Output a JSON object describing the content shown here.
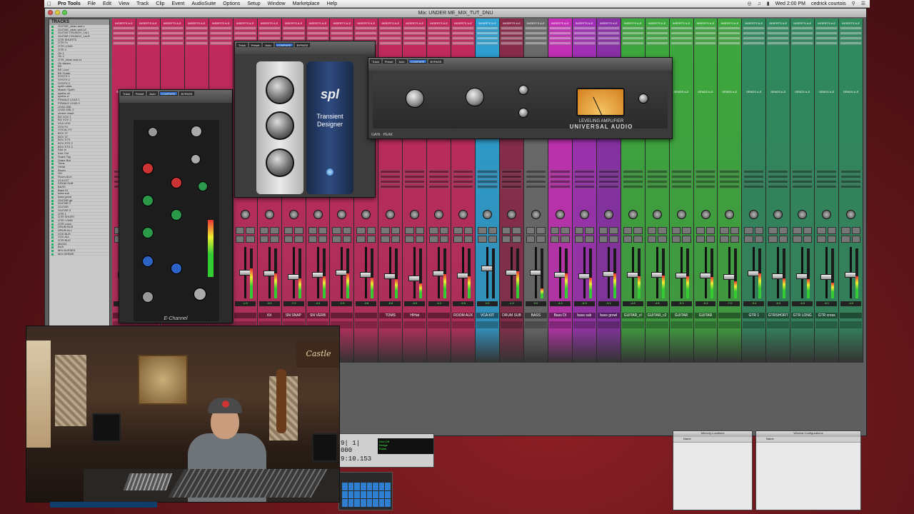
{
  "menubar": {
    "apple": "",
    "items": [
      "Pro Tools",
      "File",
      "Edit",
      "View",
      "Track",
      "Clip",
      "Event",
      "AudioSuite",
      "Options",
      "Setup",
      "Window",
      "Marketplace",
      "Help"
    ],
    "clock": "Wed 2:00 PM",
    "user": "cedrick courtois"
  },
  "window": {
    "title": "Mix: UNDER ME_MIX_TUT_DNU"
  },
  "tracks": {
    "header": "TRACKS",
    "items": [
      "GUITAR_clean and.c",
      "GUITAR_clean and.c2",
      "GUITAR CRUNCH_1st.L",
      "GUITAR CRUNCH_1st.R",
      "GTR SHORTS",
      "GTR Fx",
      "GTR LONG",
      "GTR 3",
      "Oh 1",
      "Oh 2",
      "GTR_clean and.c4",
      "Oh dream",
      "BS",
      "BS Loud",
      "BS Guitar",
      "SYNTH 1",
      "SYNTH 2",
      "SYNTH 3",
      "synth odds",
      "Master Synth",
      "synths ctr",
      "synths cl",
      "FEMALE LEAD 1",
      "FEMALE LEAD 2",
      "LEAD DBL",
      "LEAD DBL 2",
      "choice chant",
      "BG VOX 1",
      "BG VOX 2",
      "VCA VOX",
      "VOX Fx",
      "VOCAL FX",
      "BGV 2T",
      "BGV 3T",
      "BGV STS",
      "BGV STS 2",
      "BGV STS 3",
      "Kick In",
      "Kick Out",
      "Snare Top",
      "Snare Bot",
      "Toms",
      "HiHat",
      "Room",
      "OH",
      "Room AUX",
      "VCA KIT",
      "DRUM SUB",
      "BASS",
      "Bass DI",
      "bass sub",
      "bass growl",
      "GUITAR gtr",
      "GUITAR 2",
      "GUITAR",
      "GUITAR 3",
      "GTR 1",
      "GTR SHORT",
      "GTR LONG",
      "GTR cross",
      "DRUM BUS",
      "DRUM ALL",
      "VOX BUS",
      "VOX ALL",
      "GTR BUS",
      "MUSIC",
      "BUS",
      "MIX BUSSES",
      "MIX DEEMS"
    ]
  },
  "mixer": {
    "insert_label": "INSERTS A-E",
    "sends_label": "SENDS A-E",
    "strips": [
      {
        "name": "",
        "color": "#c2295c",
        "vol": "-4.0",
        "lvl": 0.45,
        "fader": 0.55
      },
      {
        "name": "",
        "color": "#c2295c",
        "vol": "-3.2",
        "lvl": 0.5,
        "fader": 0.5
      },
      {
        "name": "",
        "color": "#c2295c",
        "vol": "-6.1",
        "lvl": 0.4,
        "fader": 0.6
      },
      {
        "name": "",
        "color": "#c2295c",
        "vol": "-2.7",
        "lvl": 0.55,
        "fader": 0.45
      },
      {
        "name": "",
        "color": "#c2295c",
        "vol": "-5.0",
        "lvl": 0.35,
        "fader": 0.58
      },
      {
        "name": "",
        "color": "#c2295c",
        "vol": "-1.9",
        "lvl": 0.6,
        "fader": 0.5
      },
      {
        "name": "Kit",
        "color": "#c2295c",
        "vol": "-3.0",
        "lvl": 0.5,
        "fader": 0.52
      },
      {
        "name": "SN SNAP",
        "color": "#c2295c",
        "vol": "-7.2",
        "lvl": 0.4,
        "fader": 0.6
      },
      {
        "name": "SN VERB",
        "color": "#c2295c",
        "vol": "-4.4",
        "lvl": 0.45,
        "fader": 0.55
      },
      {
        "name": "",
        "color": "#c2295c",
        "vol": "-2.5",
        "lvl": 0.5,
        "fader": 0.5
      },
      {
        "name": "",
        "color": "#c2295c",
        "vol": "-3.8",
        "lvl": 0.42,
        "fader": 0.55
      },
      {
        "name": "TOMS",
        "color": "#c2295c",
        "vol": "-6.6",
        "lvl": 0.38,
        "fader": 0.58
      },
      {
        "name": "HIHat",
        "color": "#c2295c",
        "vol": "-9.0",
        "lvl": 0.3,
        "fader": 0.62
      },
      {
        "name": "",
        "color": "#c2295c",
        "vol": "-4.2",
        "lvl": 0.48,
        "fader": 0.52
      },
      {
        "name": "ROOM AUX",
        "color": "#c2295c",
        "vol": "-5.5",
        "lvl": 0.44,
        "fader": 0.56
      },
      {
        "name": "VCA KIT",
        "color": "#2d9fd1",
        "vol": "0.0",
        "lvl": 0.0,
        "fader": 0.4
      },
      {
        "name": "DRUM SUB",
        "color": "#8a2a4a",
        "vol": "-1.2",
        "lvl": 0.55,
        "fader": 0.5
      },
      {
        "name": "BASS",
        "color": "#6a6a6a",
        "vol": "0.0",
        "lvl": 0.2,
        "fader": 0.5
      },
      {
        "name": "Bass DI",
        "color": "#c42fb5",
        "vol": "-4.0",
        "lvl": 0.5,
        "fader": 0.55
      },
      {
        "name": "bass sub",
        "color": "#a12fb5",
        "vol": "-6.3",
        "lvl": 0.42,
        "fader": 0.58
      },
      {
        "name": "bass growl",
        "color": "#8a2fa8",
        "vol": "-3.1",
        "lvl": 0.5,
        "fader": 0.53
      },
      {
        "name": "GUITAR_cl",
        "color": "#3da83d",
        "vol": "-4.8",
        "lvl": 0.45,
        "fader": 0.55
      },
      {
        "name": "GUITAR_c2",
        "color": "#3da83d",
        "vol": "-4.8",
        "lvl": 0.46,
        "fader": 0.55
      },
      {
        "name": "GUITAR",
        "color": "#3da83d",
        "vol": "-5.3",
        "lvl": 0.44,
        "fader": 0.56
      },
      {
        "name": "GUITAR",
        "color": "#3da83d",
        "vol": "-5.3",
        "lvl": 0.43,
        "fader": 0.56
      },
      {
        "name": "",
        "color": "#3da83d",
        "vol": "-7.0",
        "lvl": 0.35,
        "fader": 0.6
      },
      {
        "name": "GTR 1",
        "color": "#2f8a5e",
        "vol": "-3.4",
        "lvl": 0.5,
        "fader": 0.52
      },
      {
        "name": "GTRSHORT",
        "color": "#2f8a5e",
        "vol": "-6.0",
        "lvl": 0.4,
        "fader": 0.58
      },
      {
        "name": "GTR LONG",
        "color": "#2f8a5e",
        "vol": "-6.5",
        "lvl": 0.38,
        "fader": 0.58
      },
      {
        "name": "GTR cross",
        "color": "#2f8a5e",
        "vol": "-8.1",
        "lvl": 0.32,
        "fader": 0.6
      },
      {
        "name": "",
        "color": "#2f8a5e",
        "vol": "-4.0",
        "lvl": 0.45,
        "fader": 0.55
      }
    ]
  },
  "plugins": {
    "echannel": {
      "title": "E-Channel",
      "track": "Track",
      "preset": "Preset",
      "auto": "Auto",
      "compare": "COMPARE",
      "bypass": "BYPASS"
    },
    "spl": {
      "brand": "spl",
      "name": "Transient\nDesigner",
      "track": "Track",
      "preset": "Preset",
      "auto": "Auto",
      "bypass": "BYPASS",
      "compare": "COMPARE"
    },
    "la2a": {
      "title": "LEVELING AMPLIFIER",
      "brand": "UNIVERSAL AUDIO",
      "track": "Track",
      "preset": "Preset",
      "auto": "Auto",
      "compare": "COMPARE",
      "bypass": "BYPASS",
      "footer": "GAIN · PEAK"
    }
  },
  "transport": {
    "counter": "9| 1| 000",
    "sub": "9:10.153",
    "lcd": "Grid Off\nNudge\nRules"
  },
  "small_windows": [
    {
      "title": "Memory Locations",
      "col1": "Name",
      "col2": ""
    },
    {
      "title": "Window Configurations",
      "col1": "Name",
      "col2": ""
    }
  ],
  "webcam": {
    "sign": "Castle",
    "label": ""
  }
}
